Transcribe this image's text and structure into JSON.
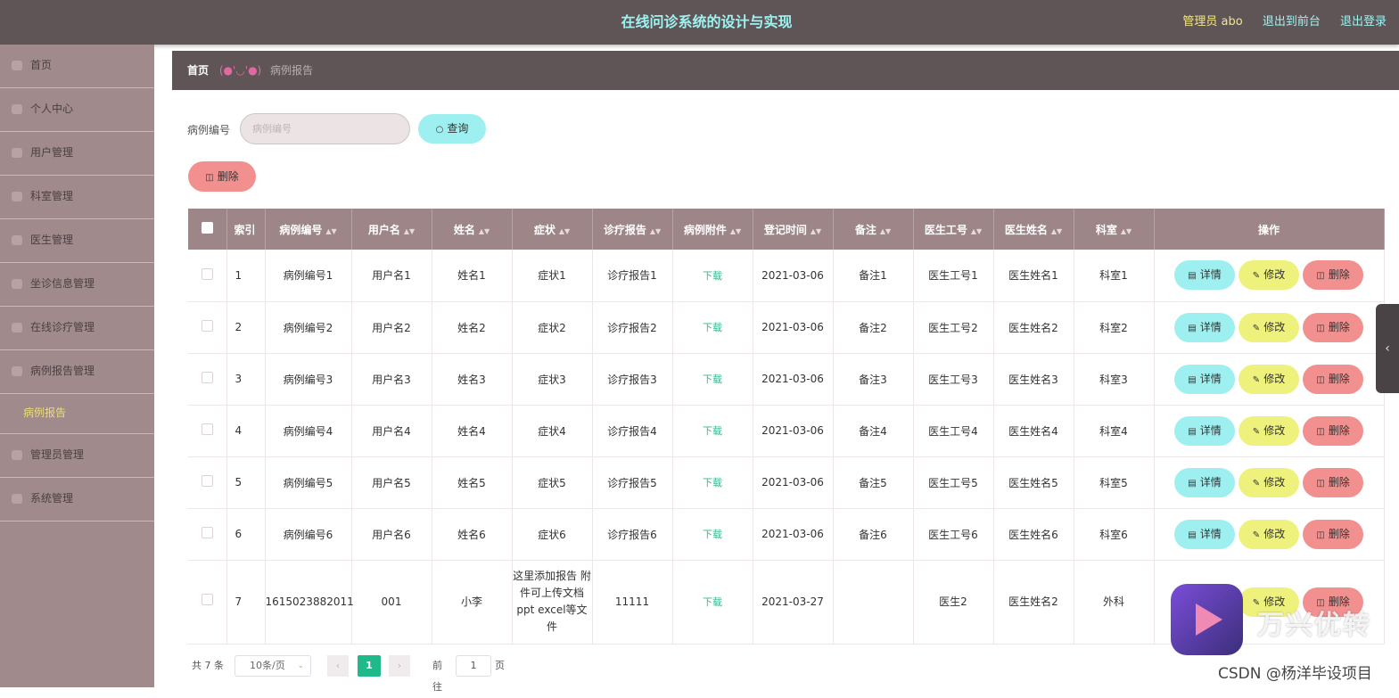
{
  "header": {
    "title": "在线问诊系统的设计与实现",
    "admin": "管理员 abo",
    "to_front": "退出到前台",
    "logout": "退出登录"
  },
  "sidebar": {
    "items": [
      {
        "label": "首页",
        "icon": "home-icon"
      },
      {
        "label": "个人中心",
        "icon": "user-icon"
      },
      {
        "label": "用户管理",
        "icon": "users-icon"
      },
      {
        "label": "科室管理",
        "icon": "department-icon"
      },
      {
        "label": "医生管理",
        "icon": "doctor-icon"
      },
      {
        "label": "坐诊信息管理",
        "icon": "schedule-icon"
      },
      {
        "label": "在线诊疗管理",
        "icon": "consult-icon"
      },
      {
        "label": "病例报告管理",
        "icon": "report-icon"
      },
      {
        "label": "管理员管理",
        "icon": "admin-icon"
      },
      {
        "label": "系统管理",
        "icon": "system-icon"
      }
    ],
    "sub_item": "病例报告"
  },
  "breadcrumb": {
    "home": "首页",
    "face": "(●'◡'●)",
    "current": "病例报告"
  },
  "search": {
    "label": "病例编号",
    "placeholder": "病例编号",
    "query_button": "查询",
    "delete_button": "删除"
  },
  "table": {
    "columns": [
      "索引",
      "病例编号",
      "用户名",
      "姓名",
      "症状",
      "诊疗报告",
      "病例附件",
      "登记时间",
      "备注",
      "医生工号",
      "医生姓名",
      "科室",
      "操作"
    ],
    "download_label": "下载",
    "actions": {
      "detail": "详情",
      "edit": "修改",
      "delete": "删除"
    },
    "rows": [
      {
        "index": "1",
        "case_no": "病例编号1",
        "username": "用户名1",
        "name": "姓名1",
        "symptom": "症状1",
        "report": "诊疗报告1",
        "date": "2021-03-06",
        "note": "备注1",
        "doc_no": "医生工号1",
        "doc_name": "医生姓名1",
        "dept": "科室1"
      },
      {
        "index": "2",
        "case_no": "病例编号2",
        "username": "用户名2",
        "name": "姓名2",
        "symptom": "症状2",
        "report": "诊疗报告2",
        "date": "2021-03-06",
        "note": "备注2",
        "doc_no": "医生工号2",
        "doc_name": "医生姓名2",
        "dept": "科室2"
      },
      {
        "index": "3",
        "case_no": "病例编号3",
        "username": "用户名3",
        "name": "姓名3",
        "symptom": "症状3",
        "report": "诊疗报告3",
        "date": "2021-03-06",
        "note": "备注3",
        "doc_no": "医生工号3",
        "doc_name": "医生姓名3",
        "dept": "科室3"
      },
      {
        "index": "4",
        "case_no": "病例编号4",
        "username": "用户名4",
        "name": "姓名4",
        "symptom": "症状4",
        "report": "诊疗报告4",
        "date": "2021-03-06",
        "note": "备注4",
        "doc_no": "医生工号4",
        "doc_name": "医生姓名4",
        "dept": "科室4"
      },
      {
        "index": "5",
        "case_no": "病例编号5",
        "username": "用户名5",
        "name": "姓名5",
        "symptom": "症状5",
        "report": "诊疗报告5",
        "date": "2021-03-06",
        "note": "备注5",
        "doc_no": "医生工号5",
        "doc_name": "医生姓名5",
        "dept": "科室5"
      },
      {
        "index": "6",
        "case_no": "病例编号6",
        "username": "用户名6",
        "name": "姓名6",
        "symptom": "症状6",
        "report": "诊疗报告6",
        "date": "2021-03-06",
        "note": "备注6",
        "doc_no": "医生工号6",
        "doc_name": "医生姓名6",
        "dept": "科室6"
      },
      {
        "index": "7",
        "case_no": "1615023882011",
        "username": "001",
        "name": "小李",
        "symptom": "这里添加报告 附件可上传文档 ppt excel等文件",
        "report": "11111",
        "date": "2021-03-27",
        "note": "",
        "doc_no": "医生2",
        "doc_name": "医生姓名2",
        "dept": "外科"
      }
    ]
  },
  "pagination": {
    "total": "共 7 条",
    "page_size": "10条/页",
    "current": "1",
    "goto_label": "前往",
    "goto_value": "1",
    "page_unit": "页"
  },
  "watermark": {
    "brand": "万兴优转",
    "csdn": "CSDN @杨洋毕设项目"
  }
}
